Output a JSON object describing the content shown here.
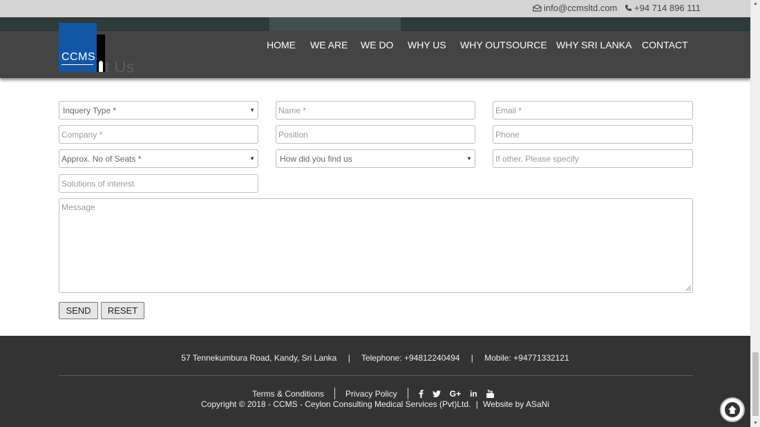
{
  "topbar": {
    "email": "info@ccmsltd.com",
    "phone": "+94 714 896 111"
  },
  "logo": {
    "text": "CCMS"
  },
  "nav": {
    "items": [
      "HOME",
      "WE ARE",
      "WE DO",
      "WHY US",
      "WHY OUTSOURCE",
      "WHY SRI LANKA",
      "CONTACT"
    ]
  },
  "page": {
    "title_fragment": "ct Us"
  },
  "form": {
    "inquiry_type": "Inquery Type *",
    "name_placeholder": "Name *",
    "email_placeholder": "Email *",
    "company_placeholder": "Company *",
    "position_placeholder": "Position",
    "phone_placeholder": "Phone",
    "seats": "Approx. No of Seats *",
    "find_us": "How did you find us",
    "other_placeholder": "If other, Please specify",
    "solutions_placeholder": "Solutions of interest",
    "message_placeholder": "Message",
    "send_label": "SEND",
    "reset_label": "RESET"
  },
  "footer": {
    "address": "57 Tennekumbura Road, Kandy, Sri Lanka",
    "telephone": "Telephone: +94812240494",
    "mobile": "Mobile: +94771332121",
    "terms": "Terms & Conditions",
    "privacy": "Privacy Policy",
    "copyright": "Copyright © 2018 - CCMS - Ceylon Consulting Medical Services (Pvt)Ltd.",
    "website_by": "Website by ASaNi",
    "social_icons": [
      "facebook-icon",
      "twitter-icon",
      "google-plus-icon",
      "linkedin-icon",
      "youtube-icon"
    ]
  }
}
